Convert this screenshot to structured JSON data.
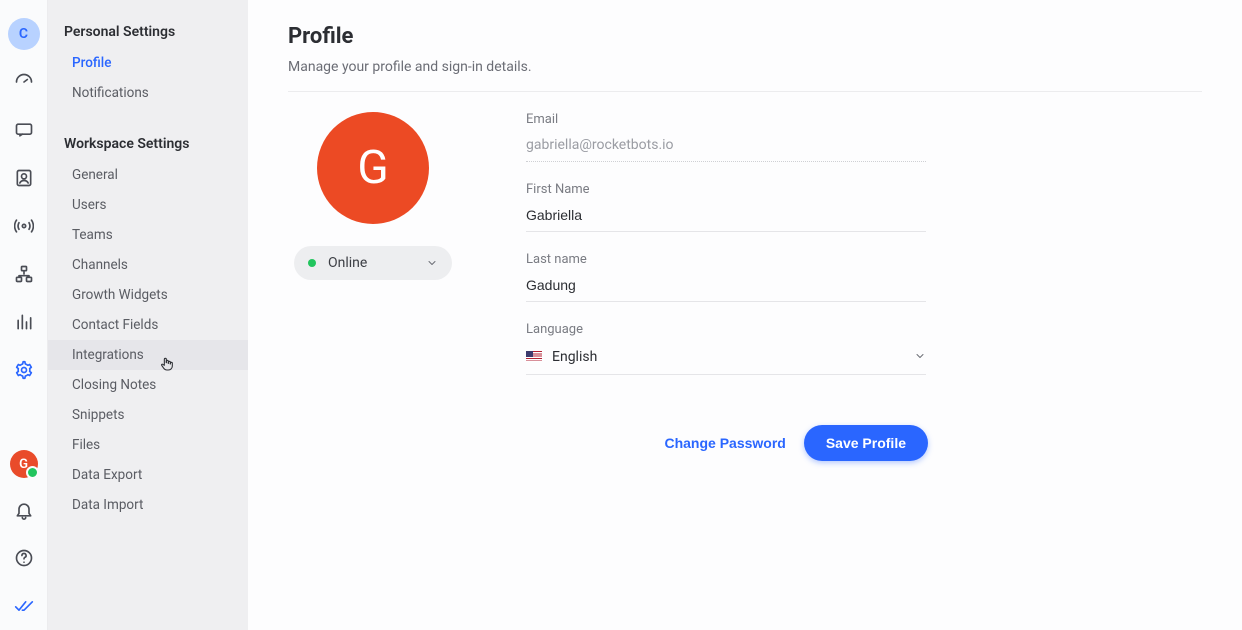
{
  "rail": {
    "org_initial": "C",
    "user_initial": "G"
  },
  "sidebar": {
    "personal_header": "Personal Settings",
    "workspace_header": "Workspace Settings",
    "personal_items": [
      {
        "label": "Profile",
        "active": true
      },
      {
        "label": "Notifications",
        "active": false
      }
    ],
    "workspace_items": [
      {
        "label": "General"
      },
      {
        "label": "Users"
      },
      {
        "label": "Teams"
      },
      {
        "label": "Channels"
      },
      {
        "label": "Growth Widgets"
      },
      {
        "label": "Contact Fields"
      },
      {
        "label": "Integrations",
        "hovered": true
      },
      {
        "label": "Closing Notes"
      },
      {
        "label": "Snippets"
      },
      {
        "label": "Files"
      },
      {
        "label": "Data Export"
      },
      {
        "label": "Data Import"
      }
    ]
  },
  "page": {
    "title": "Profile",
    "subtitle": "Manage your profile and sign-in details."
  },
  "profile": {
    "avatar_initial": "G",
    "status_label": "Online"
  },
  "fields": {
    "email_label": "Email",
    "email_value": "gabriella@rocketbots.io",
    "first_name_label": "First Name",
    "first_name_value": "Gabriella",
    "last_name_label": "Last name",
    "last_name_value": "Gadung",
    "language_label": "Language",
    "language_value": "English"
  },
  "actions": {
    "change_password": "Change Password",
    "save_profile": "Save Profile"
  }
}
